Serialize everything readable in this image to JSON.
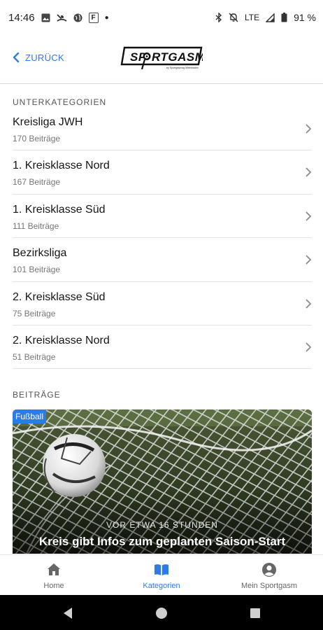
{
  "status_bar": {
    "time": "14:46",
    "network": "LTE",
    "battery": "91 %",
    "indicator_f": "F"
  },
  "header": {
    "back_label": "ZURÜCK",
    "logo_text": "SPORTGASM",
    "logo_tagline": "by Sportgasmag Mittelbaden"
  },
  "subcategories": {
    "heading": "UNTERKATEGORIEN",
    "items": [
      {
        "title": "Kreisliga JWH",
        "count": "170 Beiträge"
      },
      {
        "title": "1. Kreisklasse Nord",
        "count": "167 Beiträge"
      },
      {
        "title": "1. Kreisklasse Süd",
        "count": "111 Beiträge"
      },
      {
        "title": "Bezirksliga",
        "count": "101 Beiträge"
      },
      {
        "title": "2. Kreisklasse Süd",
        "count": "75 Beiträge"
      },
      {
        "title": "2. Kreisklasse Nord",
        "count": "51 Beiträge"
      }
    ]
  },
  "posts": {
    "heading": "BEITRÄGE",
    "items": [
      {
        "badge": "Fußball",
        "time": "VOR ETWA 16 STUNDEN",
        "title": "Kreis gibt Infos zum geplanten Saison-Start"
      }
    ]
  },
  "tab_bar": {
    "tabs": [
      {
        "label": "Home",
        "icon": "home-icon"
      },
      {
        "label": "Kategorien",
        "icon": "book-open-icon"
      },
      {
        "label": "Mein Sportgasm",
        "icon": "account-circle-icon"
      }
    ],
    "active_index": 1
  },
  "colors": {
    "accent": "#2f7be6",
    "divider": "#e3e3e3",
    "muted_text": "#777777",
    "system_nav": "#000000"
  }
}
